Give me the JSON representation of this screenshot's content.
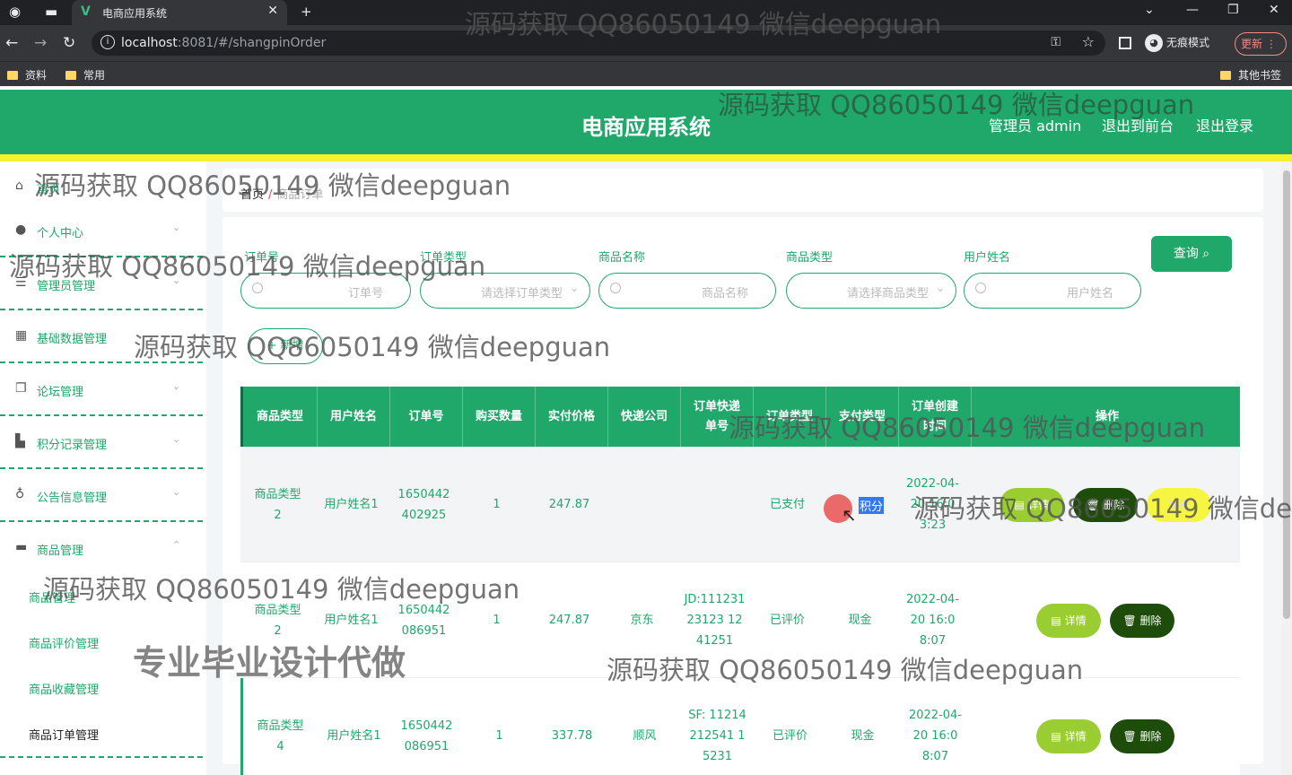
{
  "browser": {
    "tab_title": "电商应用系统",
    "url_host": "localhost",
    "url_rest": ":8081/#/shangpinOrder",
    "incognito_label": "无痕模式",
    "update_label": "更新",
    "bookmarks": [
      "资料",
      "常用"
    ],
    "other_bookmarks": "其他书签"
  },
  "header": {
    "title": "电商应用系统",
    "user_label": "管理员 admin",
    "front_link": "退出到前台",
    "logout_link": "退出登录"
  },
  "sidebar": {
    "home": "首页",
    "items": [
      {
        "label": "个人中心",
        "icon": "user-icon"
      },
      {
        "label": "管理员管理",
        "icon": "menu-icon"
      },
      {
        "label": "基础数据管理",
        "icon": "grid-icon"
      },
      {
        "label": "论坛管理",
        "icon": "copy-icon"
      },
      {
        "label": "积分记录管理",
        "icon": "stamp-icon"
      },
      {
        "label": "公告信息管理",
        "icon": "mic-icon"
      },
      {
        "label": "商品管理",
        "icon": "monitor-icon"
      }
    ],
    "sub_items": [
      "商品管理",
      "商品评价管理",
      "商品收藏管理",
      "商品订单管理"
    ]
  },
  "breadcrumb": {
    "home": "首页",
    "sep": "/",
    "current": "商品订单"
  },
  "search": {
    "fields": [
      {
        "label": "订单号",
        "placeholder": "订单号",
        "type": "text"
      },
      {
        "label": "订单类型",
        "placeholder": "请选择订单类型",
        "type": "select"
      },
      {
        "label": "商品名称",
        "placeholder": "商品名称",
        "type": "text"
      },
      {
        "label": "商品类型",
        "placeholder": "请选择商品类型",
        "type": "select"
      },
      {
        "label": "用户姓名",
        "placeholder": "用户姓名",
        "type": "text"
      }
    ],
    "query_label": "查询",
    "add_label": "新增"
  },
  "table": {
    "headers": [
      "商品类型",
      "用户姓名",
      "订单号",
      "购买数量",
      "实付价格",
      "快递公司",
      "订单快递单号",
      "订单类型",
      "支付类型",
      "订单创建时间",
      "操作"
    ],
    "rows": [
      {
        "cells": [
          "商品类型2",
          "用户姓名1",
          "1650442402925",
          "1",
          "247.87",
          "",
          "",
          "已支付",
          "积分",
          "2022-04-20 16:03:23"
        ],
        "actions": [
          "详情",
          "删除",
          "发货"
        ]
      },
      {
        "cells": [
          "商品类型2",
          "用户姓名1",
          "1650442086951",
          "1",
          "247.87",
          "京东",
          "JD:11123123123 1241251",
          "已评价",
          "现金",
          "2022-04-20 16:08:07"
        ],
        "actions": [
          "详情",
          "删除"
        ]
      },
      {
        "cells": [
          "商品类型4",
          "用户姓名1",
          "1650442086951",
          "1",
          "337.78",
          "顺风",
          "SF: 11214212541 15231",
          "已评价",
          "现金",
          "2022-04-20 16:08:07"
        ],
        "actions": [
          "详情",
          "删除"
        ]
      }
    ]
  },
  "watermarks": {
    "qq": "源码获取 QQ86050149 微信deepguan",
    "qq_cut": "源码获取 QQ86050149 微信de",
    "slogan": "专业毕业设计代做"
  },
  "colors": {
    "primary": "#1fa86a",
    "accent_yellow": "#f5f22d",
    "detail_btn": "#9acd32",
    "delete_btn": "#1e4d0b"
  }
}
